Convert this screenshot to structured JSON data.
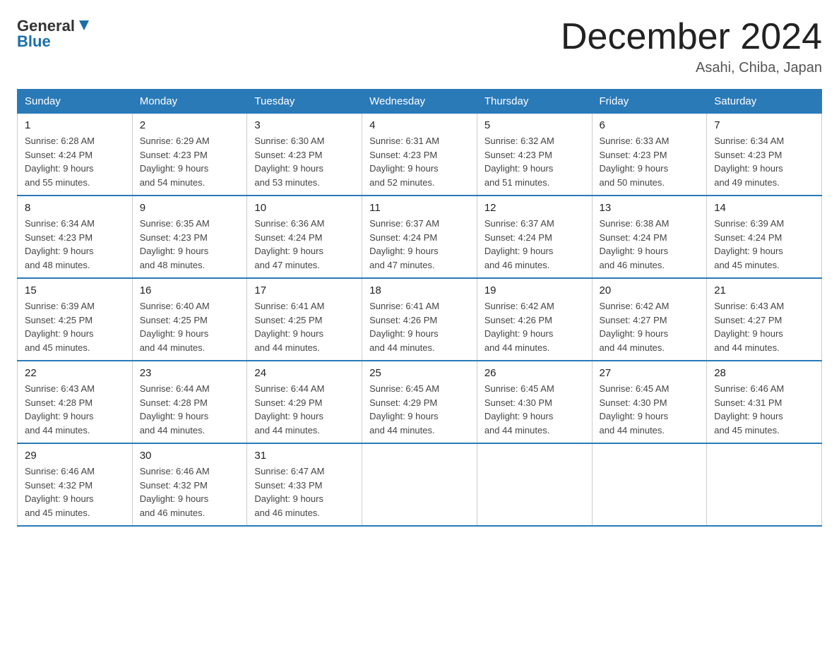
{
  "header": {
    "logo_general": "General",
    "logo_blue": "Blue",
    "month_title": "December 2024",
    "location": "Asahi, Chiba, Japan"
  },
  "days_of_week": [
    "Sunday",
    "Monday",
    "Tuesday",
    "Wednesday",
    "Thursday",
    "Friday",
    "Saturday"
  ],
  "weeks": [
    [
      {
        "day": "1",
        "sunrise": "6:28 AM",
        "sunset": "4:24 PM",
        "daylight": "9 hours and 55 minutes."
      },
      {
        "day": "2",
        "sunrise": "6:29 AM",
        "sunset": "4:23 PM",
        "daylight": "9 hours and 54 minutes."
      },
      {
        "day": "3",
        "sunrise": "6:30 AM",
        "sunset": "4:23 PM",
        "daylight": "9 hours and 53 minutes."
      },
      {
        "day": "4",
        "sunrise": "6:31 AM",
        "sunset": "4:23 PM",
        "daylight": "9 hours and 52 minutes."
      },
      {
        "day": "5",
        "sunrise": "6:32 AM",
        "sunset": "4:23 PM",
        "daylight": "9 hours and 51 minutes."
      },
      {
        "day": "6",
        "sunrise": "6:33 AM",
        "sunset": "4:23 PM",
        "daylight": "9 hours and 50 minutes."
      },
      {
        "day": "7",
        "sunrise": "6:34 AM",
        "sunset": "4:23 PM",
        "daylight": "9 hours and 49 minutes."
      }
    ],
    [
      {
        "day": "8",
        "sunrise": "6:34 AM",
        "sunset": "4:23 PM",
        "daylight": "9 hours and 48 minutes."
      },
      {
        "day": "9",
        "sunrise": "6:35 AM",
        "sunset": "4:23 PM",
        "daylight": "9 hours and 48 minutes."
      },
      {
        "day": "10",
        "sunrise": "6:36 AM",
        "sunset": "4:24 PM",
        "daylight": "9 hours and 47 minutes."
      },
      {
        "day": "11",
        "sunrise": "6:37 AM",
        "sunset": "4:24 PM",
        "daylight": "9 hours and 47 minutes."
      },
      {
        "day": "12",
        "sunrise": "6:37 AM",
        "sunset": "4:24 PM",
        "daylight": "9 hours and 46 minutes."
      },
      {
        "day": "13",
        "sunrise": "6:38 AM",
        "sunset": "4:24 PM",
        "daylight": "9 hours and 46 minutes."
      },
      {
        "day": "14",
        "sunrise": "6:39 AM",
        "sunset": "4:24 PM",
        "daylight": "9 hours and 45 minutes."
      }
    ],
    [
      {
        "day": "15",
        "sunrise": "6:39 AM",
        "sunset": "4:25 PM",
        "daylight": "9 hours and 45 minutes."
      },
      {
        "day": "16",
        "sunrise": "6:40 AM",
        "sunset": "4:25 PM",
        "daylight": "9 hours and 44 minutes."
      },
      {
        "day": "17",
        "sunrise": "6:41 AM",
        "sunset": "4:25 PM",
        "daylight": "9 hours and 44 minutes."
      },
      {
        "day": "18",
        "sunrise": "6:41 AM",
        "sunset": "4:26 PM",
        "daylight": "9 hours and 44 minutes."
      },
      {
        "day": "19",
        "sunrise": "6:42 AM",
        "sunset": "4:26 PM",
        "daylight": "9 hours and 44 minutes."
      },
      {
        "day": "20",
        "sunrise": "6:42 AM",
        "sunset": "4:27 PM",
        "daylight": "9 hours and 44 minutes."
      },
      {
        "day": "21",
        "sunrise": "6:43 AM",
        "sunset": "4:27 PM",
        "daylight": "9 hours and 44 minutes."
      }
    ],
    [
      {
        "day": "22",
        "sunrise": "6:43 AM",
        "sunset": "4:28 PM",
        "daylight": "9 hours and 44 minutes."
      },
      {
        "day": "23",
        "sunrise": "6:44 AM",
        "sunset": "4:28 PM",
        "daylight": "9 hours and 44 minutes."
      },
      {
        "day": "24",
        "sunrise": "6:44 AM",
        "sunset": "4:29 PM",
        "daylight": "9 hours and 44 minutes."
      },
      {
        "day": "25",
        "sunrise": "6:45 AM",
        "sunset": "4:29 PM",
        "daylight": "9 hours and 44 minutes."
      },
      {
        "day": "26",
        "sunrise": "6:45 AM",
        "sunset": "4:30 PM",
        "daylight": "9 hours and 44 minutes."
      },
      {
        "day": "27",
        "sunrise": "6:45 AM",
        "sunset": "4:30 PM",
        "daylight": "9 hours and 44 minutes."
      },
      {
        "day": "28",
        "sunrise": "6:46 AM",
        "sunset": "4:31 PM",
        "daylight": "9 hours and 45 minutes."
      }
    ],
    [
      {
        "day": "29",
        "sunrise": "6:46 AM",
        "sunset": "4:32 PM",
        "daylight": "9 hours and 45 minutes."
      },
      {
        "day": "30",
        "sunrise": "6:46 AM",
        "sunset": "4:32 PM",
        "daylight": "9 hours and 46 minutes."
      },
      {
        "day": "31",
        "sunrise": "6:47 AM",
        "sunset": "4:33 PM",
        "daylight": "9 hours and 46 minutes."
      },
      null,
      null,
      null,
      null
    ]
  ],
  "labels": {
    "sunrise": "Sunrise:",
    "sunset": "Sunset:",
    "daylight": "Daylight:"
  }
}
